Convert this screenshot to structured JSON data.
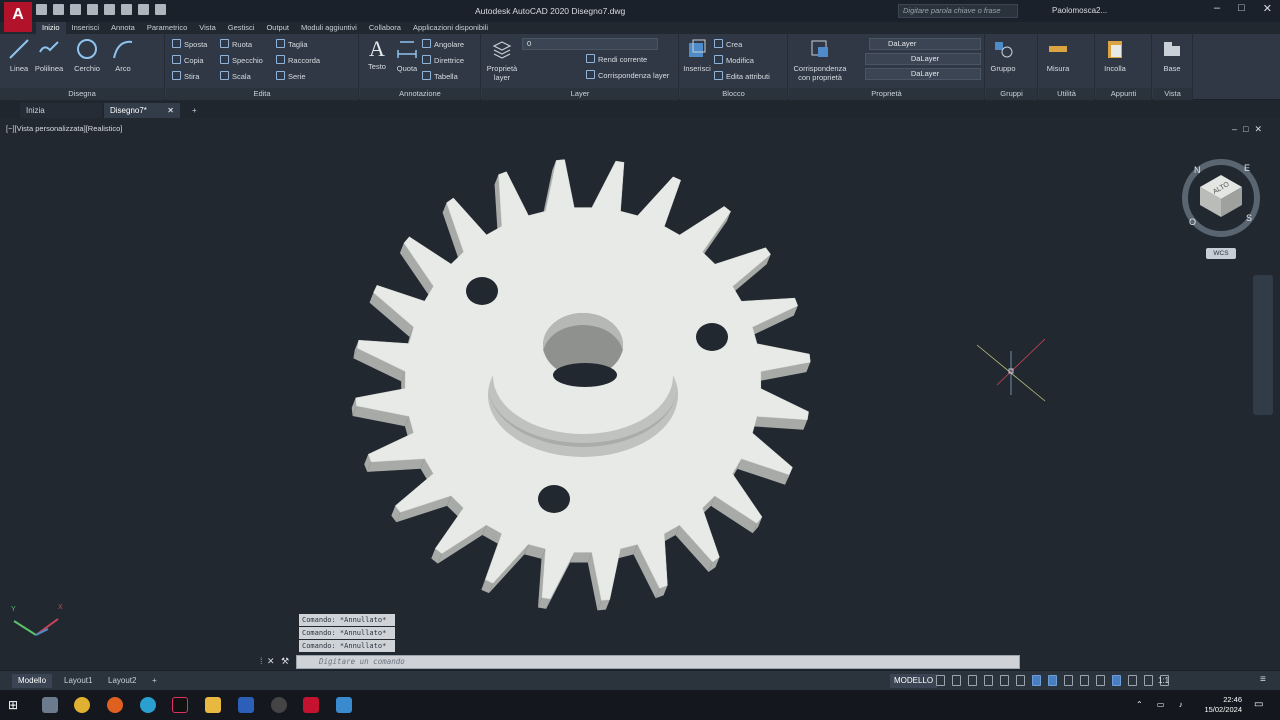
{
  "titlebar": {
    "app_logo": "A",
    "title": "Autodesk AutoCAD 2020   Disegno7.dwg",
    "search_placeholder": "Digitare parola chiave o frase",
    "user": "Paolomosca2..."
  },
  "ribbon_tabs": [
    "Inizio",
    "Inserisci",
    "Annota",
    "Parametrico",
    "Vista",
    "Gestisci",
    "Output",
    "Moduli aggiuntivi",
    "Collabora",
    "Applicazioni disponibili"
  ],
  "ribbon": {
    "draw": {
      "title": "Disegna",
      "line": "Linea",
      "polyline": "Polilinea",
      "circle": "Cerchio",
      "arc": "Arco"
    },
    "modify": {
      "title": "Edita",
      "move": "Sposta",
      "rotate": "Ruota",
      "trim": "Taglia",
      "copy": "Copia",
      "mirror": "Specchio",
      "fillet": "Raccorda",
      "stretch": "Stira",
      "scale": "Scala",
      "array": "Serie"
    },
    "annotation": {
      "title": "Annotazione",
      "text": "Testo",
      "dimension": "Quota",
      "angular": "Angolare",
      "leader": "Direttrice",
      "table": "Tabella"
    },
    "layers": {
      "title": "Layer",
      "properties": "Proprietà layer",
      "current_layer": "0",
      "make_current": "Rendi corrente",
      "match_layer": "Corrispondenza layer"
    },
    "block": {
      "title": "Blocco",
      "insert": "Inserisci",
      "create": "Crea",
      "edit": "Modifica",
      "edit_attributes": "Edita attributi"
    },
    "properties": {
      "title": "Proprietà",
      "match": "Corrispondenza con proprietà",
      "color": "DaLayer",
      "linetype": "DaLayer",
      "lineweight": "DaLayer"
    },
    "groups": {
      "title": "Gruppi",
      "group": "Gruppo"
    },
    "utilities": {
      "title": "Utilità",
      "measure": "Misura"
    },
    "clipboard": {
      "title": "Appunti",
      "paste": "Incolla"
    },
    "view": {
      "title": "Vista",
      "base": "Base"
    }
  },
  "file_tabs": {
    "start": "Inizia",
    "drawing": "Disegno7*"
  },
  "viewport": {
    "label": "[−][Vista personalizzata][Realistico]",
    "viewcube_face": "ALTO",
    "compass": {
      "north": "N",
      "east": "E",
      "south": "S",
      "west": "O"
    },
    "wcs": "WCS"
  },
  "command": {
    "history": [
      "Comando: *Annullato*",
      "Comando: *Annullato*",
      "Comando: *Annullato*"
    ],
    "placeholder": "Digitare un comando"
  },
  "layout_tabs": [
    "Modello",
    "Layout1",
    "Layout2",
    "+"
  ],
  "status": {
    "model": "MODELLO",
    "scale": "1:1"
  },
  "taskbar": {
    "time": "22:46",
    "date": "15/02/2024"
  },
  "colors": {
    "accent": "#b2122a",
    "background": "#212830",
    "gear": "#e8eae7"
  }
}
